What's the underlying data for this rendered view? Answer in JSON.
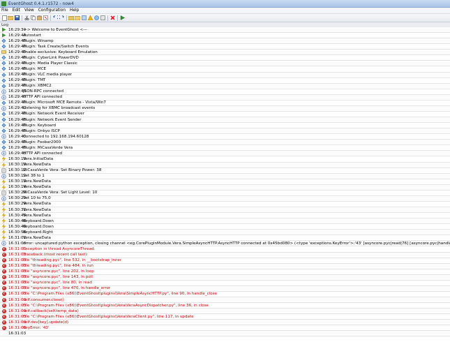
{
  "window": {
    "title": "EventGhost 0.4.1.r1572 - now4"
  },
  "menu": [
    "File",
    "Edit",
    "View",
    "Configuration",
    "Help"
  ],
  "pane_title": "Log",
  "colors": {
    "error": "#c00000",
    "plugin": "#2e6fb3",
    "event": "#e6a000"
  },
  "rows": [
    {
      "icon": "play",
      "time": "16:29:39",
      "msg": "---> Welcome to EventGhost <---"
    },
    {
      "icon": "play",
      "time": "16:29:40",
      "msg": "Autostart"
    },
    {
      "icon": "plugin",
      "time": "16:29:40",
      "msg": "    Plugin: Winamp"
    },
    {
      "icon": "plugin",
      "time": "16:29:40",
      "msg": "    Plugin: Task Create/Switch Events"
    },
    {
      "icon": "keyboard",
      "time": "16:29:40",
      "msg": "    Enable exclusive: Keyboard Emulation"
    },
    {
      "icon": "plugin",
      "time": "16:29:40",
      "msg": "    Plugin: CyberLink PowerDVD"
    },
    {
      "icon": "plugin",
      "time": "16:29:40",
      "msg": "    Plugin: Media Player Classic"
    },
    {
      "icon": "plugin",
      "time": "16:29:40",
      "msg": "    Plugin: MCE"
    },
    {
      "icon": "plugin",
      "time": "16:29:40",
      "msg": "    Plugin: VLC media player"
    },
    {
      "icon": "plugin",
      "time": "16:29:40",
      "msg": "    Plugin: TMT"
    },
    {
      "icon": "plugin",
      "time": "16:29:40",
      "msg": "    Plugin: XBMC2"
    },
    {
      "icon": "info",
      "time": "16:29:40",
      "msg": "      JSON-RPC connected"
    },
    {
      "icon": "info",
      "time": "16:29:40",
      "msg": "      HTTP API connected"
    },
    {
      "icon": "plugin",
      "time": "16:29:40",
      "msg": "    Plugin: Microsoft MCE Remote - Vista/Win7"
    },
    {
      "icon": "info",
      "time": "16:29:40",
      "msg": "      Listening for XBMC broadcast events"
    },
    {
      "icon": "plugin",
      "time": "16:29:40",
      "msg": "    Plugin: Network Event Receiver"
    },
    {
      "icon": "plugin",
      "time": "16:29:40",
      "msg": "    Plugin: Network Event Sender"
    },
    {
      "icon": "plugin",
      "time": "16:29:40",
      "msg": "    Plugin: Keyboard"
    },
    {
      "icon": "plugin",
      "time": "16:29:40",
      "msg": "    Plugin: Onkyo ISCP"
    },
    {
      "icon": "info",
      "time": "16:29:40",
      "msg": "      Connected to 192.168.194.60128"
    },
    {
      "icon": "plugin",
      "time": "16:29:40",
      "msg": "    Plugin: Foobar2000"
    },
    {
      "icon": "plugin",
      "time": "16:29:40",
      "msg": "    Plugin: MiCasaVerde Vera"
    },
    {
      "icon": "info",
      "time": "16:29:40",
      "msg": "      HTTP API connected"
    },
    {
      "icon": "event",
      "time": "16:30:10",
      "msg": "Vera.InitialData"
    },
    {
      "icon": "event",
      "time": "16:30:10",
      "msg": "Vera.NewData"
    },
    {
      "icon": "device",
      "time": "16:30:12",
      "msg": "MiCasaVerde Vera: Set Binary Power: 38"
    },
    {
      "icon": "info",
      "time": "16:30:12",
      "msg": "    Set 38 to 1"
    },
    {
      "icon": "event",
      "time": "16:30:13",
      "msg": "Vera.NewData"
    },
    {
      "icon": "event",
      "time": "16:30:14",
      "msg": "Vera.NewData"
    },
    {
      "icon": "device",
      "time": "16:30:29",
      "msg": "MiCasaVerde Vera: Set Light Level: 10"
    },
    {
      "icon": "info",
      "time": "16:30:29",
      "msg": "    Set 10 to 75.0"
    },
    {
      "icon": "event",
      "time": "16:30:29",
      "msg": "Vera.NewData"
    },
    {
      "icon": "event",
      "time": "16:30:31",
      "msg": "Vera.NewData"
    },
    {
      "icon": "event",
      "time": "16:30:45",
      "msg": "Vera.NewData"
    },
    {
      "icon": "event",
      "time": "16:30:48",
      "msg": "Keyboard.Down"
    },
    {
      "icon": "event",
      "time": "16:30:49",
      "msg": "Keyboard.Down"
    },
    {
      "icon": "event",
      "time": "16:30:58",
      "msg": "Keyboard.Right"
    },
    {
      "icon": "event",
      "time": "16:31:01",
      "msg": "Vera.NewData"
    },
    {
      "icon": "info",
      "time": "16:31:03",
      "msg": "error: uncaptured python exception, closing channel <eg.CorePluginModule.Vera.SimpleAsyncHTTP.AsyncHTTP connected at 0x45bd080> (<type 'exceptions.KeyError'>:'43' [asyncore.pyc|read|76] [asyncore.pyc|handle_read_event|416] [C:\\Program Files (x86)\\"
    },
    {
      "icon": "error",
      "time": "16:31:03",
      "msg": "Exception in thread AsyncoreThread:",
      "err": true
    },
    {
      "icon": "error",
      "time": "16:31:03",
      "msg": "Traceback (most recent call last):",
      "err": true
    },
    {
      "icon": "error",
      "time": "16:31:03",
      "msg": "  File \"threading.pyc\", line 532, in __bootstrap_inner",
      "err": true
    },
    {
      "icon": "error",
      "time": "16:31:03",
      "msg": "  File \"threading.pyc\", line 484, in run",
      "err": true
    },
    {
      "icon": "error",
      "time": "16:31:03",
      "msg": "  File \"asyncore.pyc\", line 202, in loop",
      "err": true
    },
    {
      "icon": "error",
      "time": "16:31:03",
      "msg": "  File \"asyncore.pyc\", line 143, in poll",
      "err": true
    },
    {
      "icon": "error",
      "time": "16:31:03",
      "msg": "  File \"asyncore.pyc\", line 80, in read",
      "err": true
    },
    {
      "icon": "error",
      "time": "16:31:03",
      "msg": "  File \"asyncore.pyc\", line 470, in handle_error",
      "err": true
    },
    {
      "icon": "error",
      "time": "16:31:03",
      "msg": "  File \"C:\\Program Files (x86)\\EventGhost\\plugins\\Vera\\SimpleAsyncHTTP.py\", line 90, in handle_close",
      "err": true
    },
    {
      "icon": "error",
      "time": "16:31:03",
      "msg": "    self.consumer.close()",
      "err": true
    },
    {
      "icon": "error",
      "time": "16:31:03",
      "msg": "  File \"C:\\Program Files (x86)\\EventGhost\\plugins\\Vera\\VeraAsyncDispatcher.py\", line 36, in close",
      "err": true
    },
    {
      "icon": "error",
      "time": "16:31:03",
      "msg": "    self.callback(self.temp_data)",
      "err": true
    },
    {
      "icon": "error",
      "time": "16:31:03",
      "msg": "  File \"C:\\Program Files (x86)\\EventGhost\\plugins\\Vera\\VeraClient.py\", line 117, in update",
      "err": true
    },
    {
      "icon": "error",
      "time": "16:31:03",
      "msg": "    self.dev[key].update(d)",
      "err": true
    },
    {
      "icon": "error",
      "time": "16:31:03",
      "msg": "KeyError: '43'",
      "err": true
    },
    {
      "icon": "none",
      "time": "16:31:03",
      "msg": ""
    }
  ]
}
